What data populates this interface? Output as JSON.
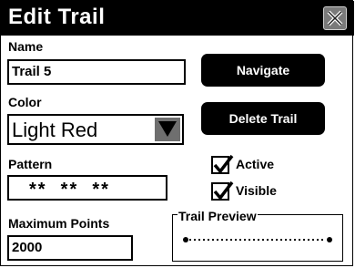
{
  "dialog": {
    "title": "Edit Trail",
    "close_icon": "close-x-icon"
  },
  "form": {
    "name_label": "Name",
    "name_value": "Trail 5",
    "color_label": "Color",
    "color_value": "Light Red",
    "pattern_label": "Pattern",
    "pattern_value": "**  **  **",
    "max_points_label": "Maximum Points",
    "max_points_value": "2000"
  },
  "buttons": {
    "navigate": "Navigate",
    "delete": "Delete Trail"
  },
  "options": {
    "active_label": "Active",
    "active_checked": true,
    "visible_label": "Visible",
    "visible_checked": true
  },
  "preview": {
    "title": "Trail Preview"
  }
}
